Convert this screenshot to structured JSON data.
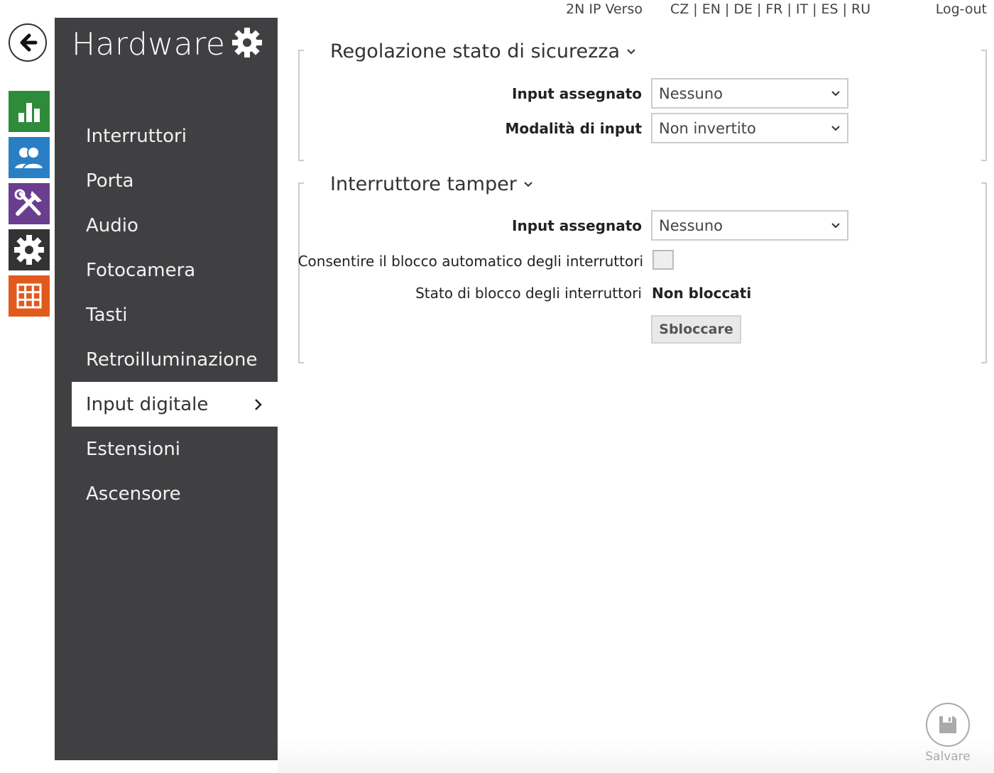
{
  "topbar": {
    "device_name": "2N IP Verso",
    "languages": [
      "CZ",
      "EN",
      "DE",
      "FR",
      "IT",
      "ES",
      "RU"
    ],
    "logout_label": "Log-out"
  },
  "rail": {
    "tiles": [
      {
        "name": "status-icon",
        "color": "#2e8b3a"
      },
      {
        "name": "directory-icon",
        "color": "#2a7fc4"
      },
      {
        "name": "hardware-icon",
        "color": "#6a3d8f"
      },
      {
        "name": "services-icon",
        "color": "#333336"
      },
      {
        "name": "system-icon",
        "color": "#e05a1c"
      }
    ]
  },
  "sidebar": {
    "title": "Hardware",
    "items": [
      {
        "label": "Interruttori"
      },
      {
        "label": "Porta"
      },
      {
        "label": "Audio"
      },
      {
        "label": "Fotocamera"
      },
      {
        "label": "Tasti"
      },
      {
        "label": "Retroilluminazione"
      },
      {
        "label": "Input digitale",
        "active": true
      },
      {
        "label": "Estensioni"
      },
      {
        "label": "Ascensore"
      }
    ]
  },
  "sections": {
    "security": {
      "title": "Regolazione stato di sicurezza",
      "input_label": "Input assegnato",
      "input_value": "Nessuno",
      "mode_label": "Modalità di input",
      "mode_value": "Non invertito"
    },
    "tamper": {
      "title": "Interruttore tamper",
      "input_label": "Input assegnato",
      "input_value": "Nessuno",
      "auto_block_label": "Consentire il blocco automatico degli interruttori",
      "auto_block_checked": false,
      "block_state_label": "Stato di blocco degli interruttori",
      "block_state_value": "Non bloccati",
      "unlock_label": "Sbloccare"
    }
  },
  "save": {
    "label": "Salvare"
  }
}
